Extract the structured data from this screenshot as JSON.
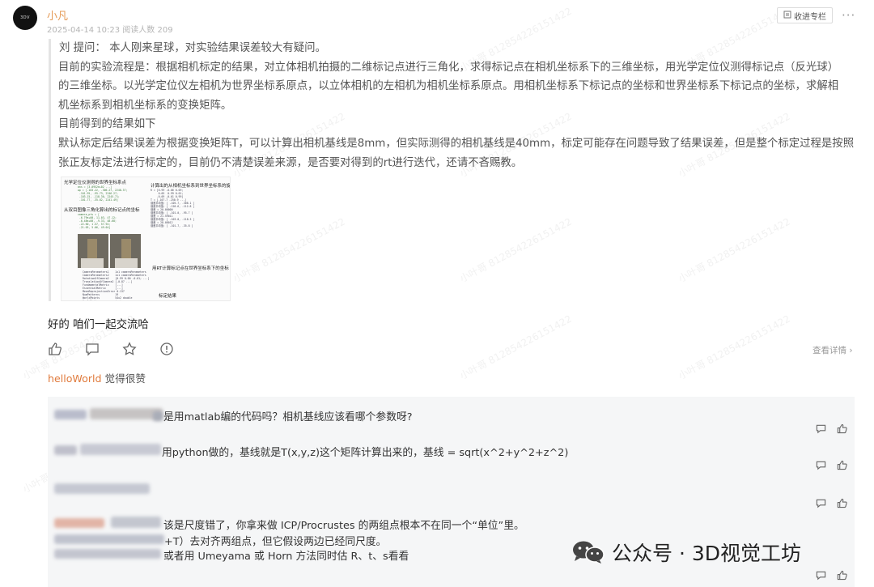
{
  "post": {
    "author": "小凡",
    "meta": "2025-04-14 10:23  阅读人数 209",
    "collect_label": "收进专栏",
    "more": "···"
  },
  "quote": {
    "paragraphs": [
      "刘 提问： 本人刚来星球，对实验结果误差较大有疑问。",
      "目前的实验流程是：根据相机标定的结果，对立体相机拍摄的二维标记点进行三角化，求得标记点在相机坐标系下的三维坐标，用光学定位仪测得标记点（反光球）",
      "的三维坐标。以光学定位仪左相机为世界坐标系原点，以立体相机的左相机为相机坐标系原点。用相机坐标系下标记点的坐标和世界坐标系下标记点的坐标，求解相",
      "机坐标系到相机坐标系的变换矩阵。",
      "目前得到的结果如下",
      "默认标定后结果误差为根据变换矩阵T，可以计算出相机基线是8mm，但实际测得的相机基线是40mm，标定可能存在问题导致了结果误差，但是整个标定过程是按照",
      "张正友标定法进行标定的，目前仍不清楚误差来源，是否要对得到的rt进行迭代，还请不吝赐教。"
    ],
    "figure": {
      "cap1": "光学定位仪测得的世界坐标系点",
      "cap2": "计算出的从相机坐标系到世界坐标系的旋转平移矩阵",
      "cap3": "从双目图像三角化算出的标记点的坐标",
      "cap4": "用RT计算标记点在世界坐标系下的坐标",
      "cap5": "标定结果"
    }
  },
  "reply": "好的 咱们一起交流哈",
  "actions": {
    "like_icon": "thumbs-up-icon",
    "comment_icon": "comment-icon",
    "star_icon": "star-icon",
    "report_icon": "alert-circle-icon",
    "detail_label": "查看详情 ›"
  },
  "liked": {
    "user": "helloWorld",
    "text": " 觉得很赞"
  },
  "comments": [
    {
      "text": "是用matlab编的代码吗？相机基线应该看哪个参数呀?"
    },
    {
      "text": "用python做的，基线就是T(x,y,z)这个矩阵计算出来的，基线 = sqrt(x^2+y^2+z^2)"
    },
    {
      "text": ""
    },
    {
      "lines": [
        "该是尺度错了，你拿来做 ICP/Procrustes 的两组点根本不在同一个“单位”里。",
        "+T）去对齐两组点，但它假设两边已经同尺度。",
        "或者用 Umeyama 或 Horn 方法同时估 R、t、s看看"
      ]
    }
  ],
  "brand": {
    "label": "公众号 · 3D视觉工坊"
  },
  "colors": {
    "author": "#e59a55",
    "liked_user": "#e07b3d",
    "comment_bg": "#f5f6f7"
  }
}
